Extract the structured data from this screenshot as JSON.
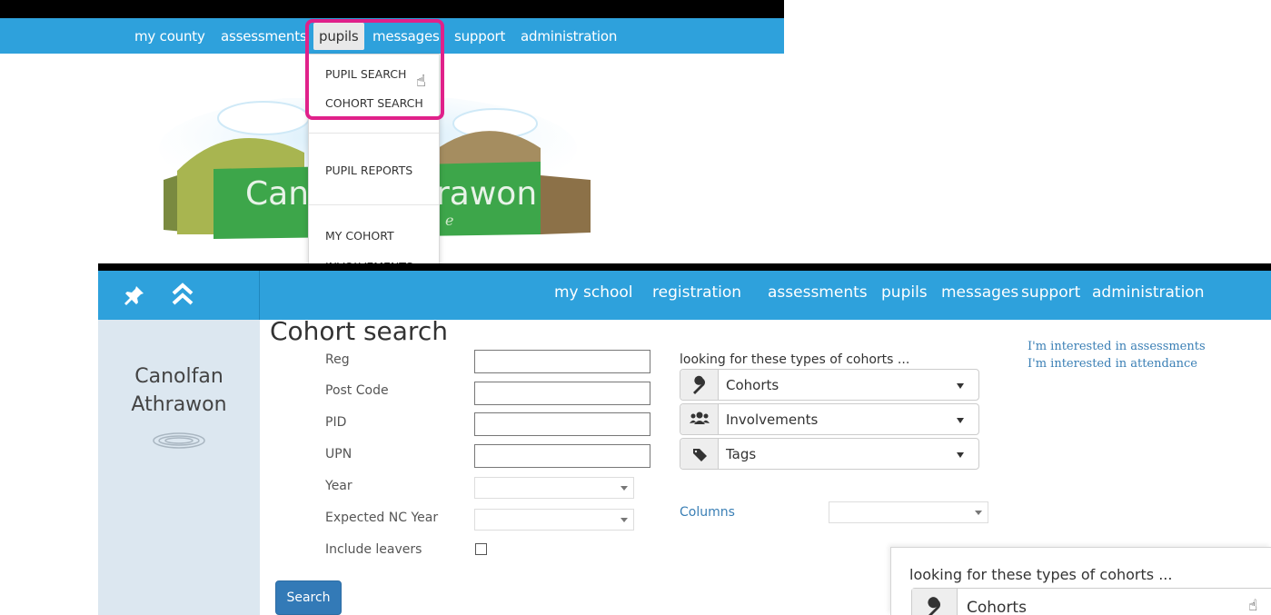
{
  "top_nav": {
    "items": [
      "my county",
      "assessments",
      "pupils",
      "messages",
      "support",
      "administration"
    ],
    "active": "pupils"
  },
  "pupils_menu": {
    "items": [
      "PUPIL SEARCH",
      "COHORT SEARCH",
      "PUPIL REPORTS",
      "MY COHORT",
      "INVOLVEMENTS"
    ]
  },
  "banner": {
    "text_left": "Canc",
    "text_right": "rawon",
    "tagline": "e"
  },
  "main_nav": {
    "items": [
      "my school",
      "registration",
      "assessments",
      "pupils",
      "messages",
      "support",
      "administration"
    ]
  },
  "sidebar": {
    "brand_line1": "Canolfan",
    "brand_line2": "Athrawon"
  },
  "page": {
    "title": "Cohort search"
  },
  "form": {
    "reg_label": "Reg",
    "postcode_label": "Post Code",
    "pid_label": "PID",
    "upn_label": "UPN",
    "year_label": "Year",
    "expected_nc_year_label": "Expected NC Year",
    "include_leavers_label": "Include leavers",
    "reg_value": "",
    "postcode_value": "",
    "pid_value": "",
    "upn_value": "",
    "year_value": "",
    "expected_nc_year_value": "",
    "include_leavers_checked": false,
    "search_button": "Search"
  },
  "filters": {
    "heading": "looking for these types of cohorts ...",
    "cohorts": "Cohorts",
    "involvements": "Involvements",
    "tags": "Tags",
    "columns_label": "Columns",
    "columns_value": ""
  },
  "links": {
    "assessments": "I'm interested in assessments",
    "attendance": "I'm interested in attendance"
  },
  "zoom": {
    "heading": "looking for these types of cohorts ...",
    "cohorts": "Cohorts"
  },
  "colors": {
    "nav_blue": "#2ea1dc",
    "highlight": "#e0218a",
    "sidebar": "#dce7f0",
    "button": "#337ab7",
    "link": "#3a7fb5"
  }
}
